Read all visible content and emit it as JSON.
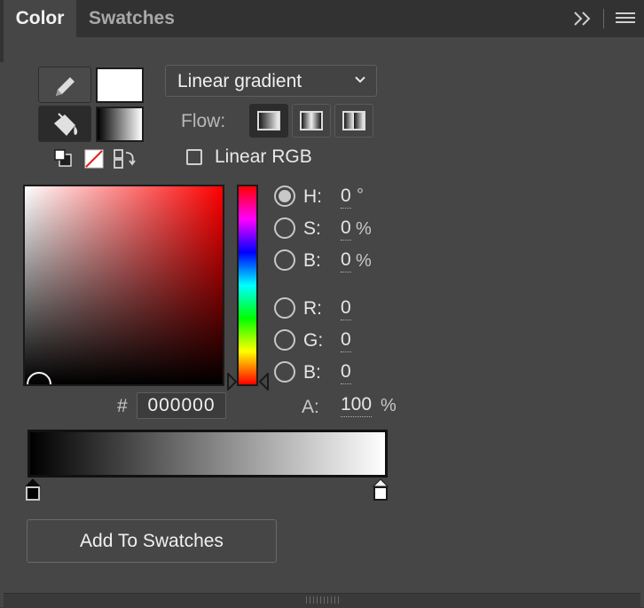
{
  "tabs": [
    {
      "label": "Color",
      "active": true
    },
    {
      "label": "Swatches",
      "active": false
    }
  ],
  "tab_controls": {
    "collapse_icon": "double-chevron-right-icon",
    "menu_icon": "hamburger-menu-icon"
  },
  "tools": {
    "stroke_icon": "pencil-icon",
    "fill_icon": "paint-bucket-icon",
    "stroke_color": "#ffffff",
    "fill_gradient": [
      "#000000",
      "#ffffff"
    ],
    "small_icons": [
      "default-colors-icon",
      "no-color-icon",
      "swap-colors-icon"
    ]
  },
  "fill_type": {
    "selected": "Linear gradient"
  },
  "flow": {
    "label": "Flow:",
    "options": [
      "extend",
      "reflect",
      "repeat"
    ],
    "selected_index": 0
  },
  "linear_rgb": {
    "label": "Linear RGB",
    "checked": false
  },
  "channels": {
    "h": {
      "label": "H:",
      "value": "0",
      "unit": "°",
      "selected": true
    },
    "s": {
      "label": "S:",
      "value": "0",
      "unit": "%"
    },
    "b_hsb": {
      "label": "B:",
      "value": "0",
      "unit": "%"
    },
    "r": {
      "label": "R:",
      "value": "0"
    },
    "g": {
      "label": "G:",
      "value": "0"
    },
    "b_rgb": {
      "label": "B:",
      "value": "0"
    },
    "a": {
      "label": "A:",
      "value": "100",
      "unit": "%"
    }
  },
  "hex": {
    "prefix": "#",
    "value": "000000"
  },
  "gradient": {
    "stops": [
      "#000000",
      "#ffffff"
    ]
  },
  "add_button": {
    "label": "Add To Swatches"
  }
}
